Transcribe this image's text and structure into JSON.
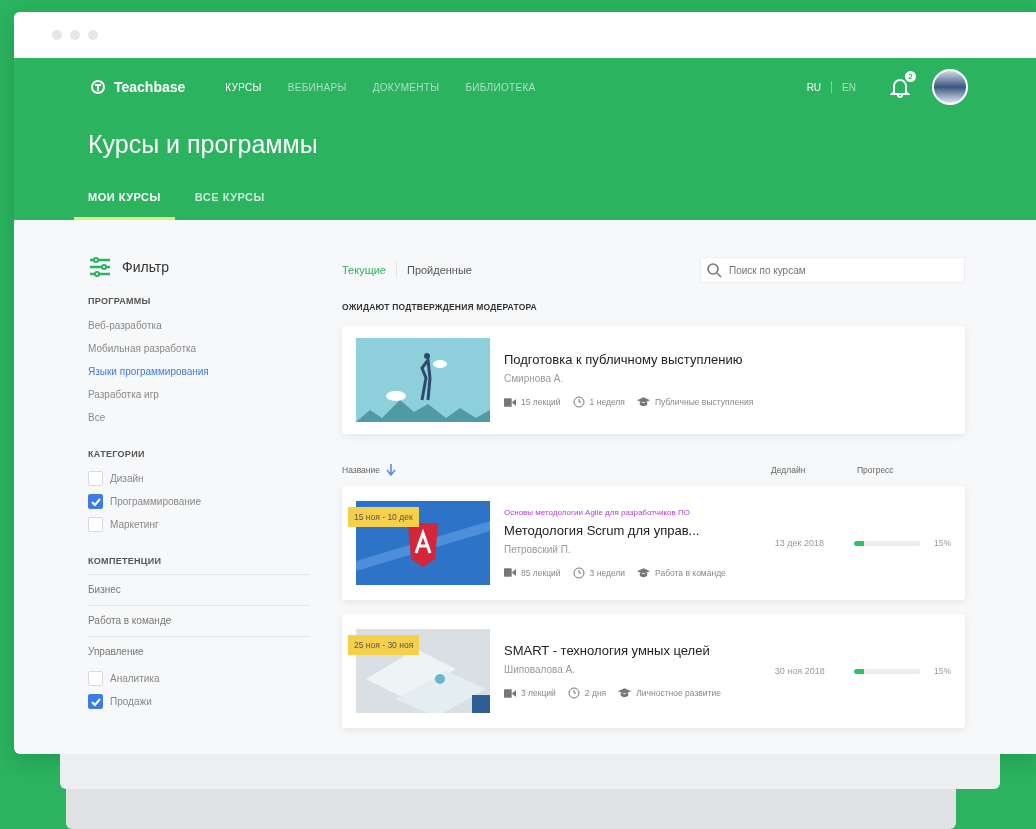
{
  "nav": {
    "logo": "Teachbase",
    "items": [
      {
        "label": "КУРСЫ",
        "selected": true
      },
      {
        "label": "ВЕБИНАРЫ",
        "selected": false
      },
      {
        "label": "ДОКУМЕНТЫ",
        "selected": false
      },
      {
        "label": "БИБЛИОТЕКА",
        "selected": false
      }
    ],
    "languages": [
      {
        "label": "RU",
        "selected": true
      },
      {
        "label": "EN",
        "selected": false
      }
    ],
    "notifications": "2"
  },
  "page_title": "Курсы и программы",
  "tabs": [
    {
      "label": "МОИ КУРСЫ",
      "selected": true
    },
    {
      "label": "ВСЕ КУРСЫ",
      "selected": false
    }
  ],
  "filter": {
    "title": "Фильтр",
    "programs": {
      "heading": "ПРОГРАММЫ",
      "items": [
        {
          "label": "Веб-разработка",
          "selected": false
        },
        {
          "label": "Мобильная разработка",
          "selected": false
        },
        {
          "label": "Языки программирования",
          "selected": true
        },
        {
          "label": "Разработка игр",
          "selected": false
        },
        {
          "label": "Все",
          "selected": false
        }
      ]
    },
    "categories": {
      "heading": "КАТЕГОРИИ",
      "items": [
        {
          "label": "Дизайн",
          "checked": false
        },
        {
          "label": "Программирование",
          "checked": true
        },
        {
          "label": "Маркетинг",
          "checked": false
        }
      ]
    },
    "competencies": {
      "heading": "КОМПЕТЕНЦИИ",
      "groups": [
        "Бизнес",
        "Работа в команде",
        "Управление"
      ],
      "items": [
        {
          "label": "Аналитика",
          "checked": false
        },
        {
          "label": "Продажи",
          "checked": true
        }
      ]
    }
  },
  "status_tabs": [
    {
      "label": "Текущие",
      "selected": true
    },
    {
      "label": "Пройденные",
      "selected": false
    }
  ],
  "search": {
    "placeholder": "Поиск по курсам"
  },
  "pending": {
    "heading": "ОЖИДАЮТ ПОДТВЕРЖДЕНИЯ МОДЕРАТОРА",
    "course": {
      "title": "Подготовка к публичному выступлению",
      "author": "Смирнова А.",
      "lectures": "15 лекций",
      "duration": "1 неделя",
      "topic": "Публичные выступления"
    }
  },
  "table": {
    "columns": [
      "Название",
      "Дедлайн",
      "Прогресс"
    ],
    "rows": [
      {
        "kind": "code",
        "program": "Основы методологии Agile для разработчиков ПО",
        "dates": "15 ноя - 10 дек",
        "title": "Методология Scrum для управ...",
        "author": "Петровский П.",
        "lectures": "85 лекций",
        "duration": "3 недели",
        "topic": "Работа в команде",
        "deadline": "13 дек 2018",
        "level": 0.15,
        "progress": "15%"
      },
      {
        "kind": "slides",
        "dates": "25 ноя - 30 ноя",
        "title": "SMART - технология умных целей",
        "author": "Шиповалова А.",
        "lectures": "3 лекций",
        "duration": "2 дня",
        "topic": "Личностное развитие",
        "deadline": "30 ноя 2018",
        "level": 0.15,
        "progress": "15%"
      }
    ]
  }
}
